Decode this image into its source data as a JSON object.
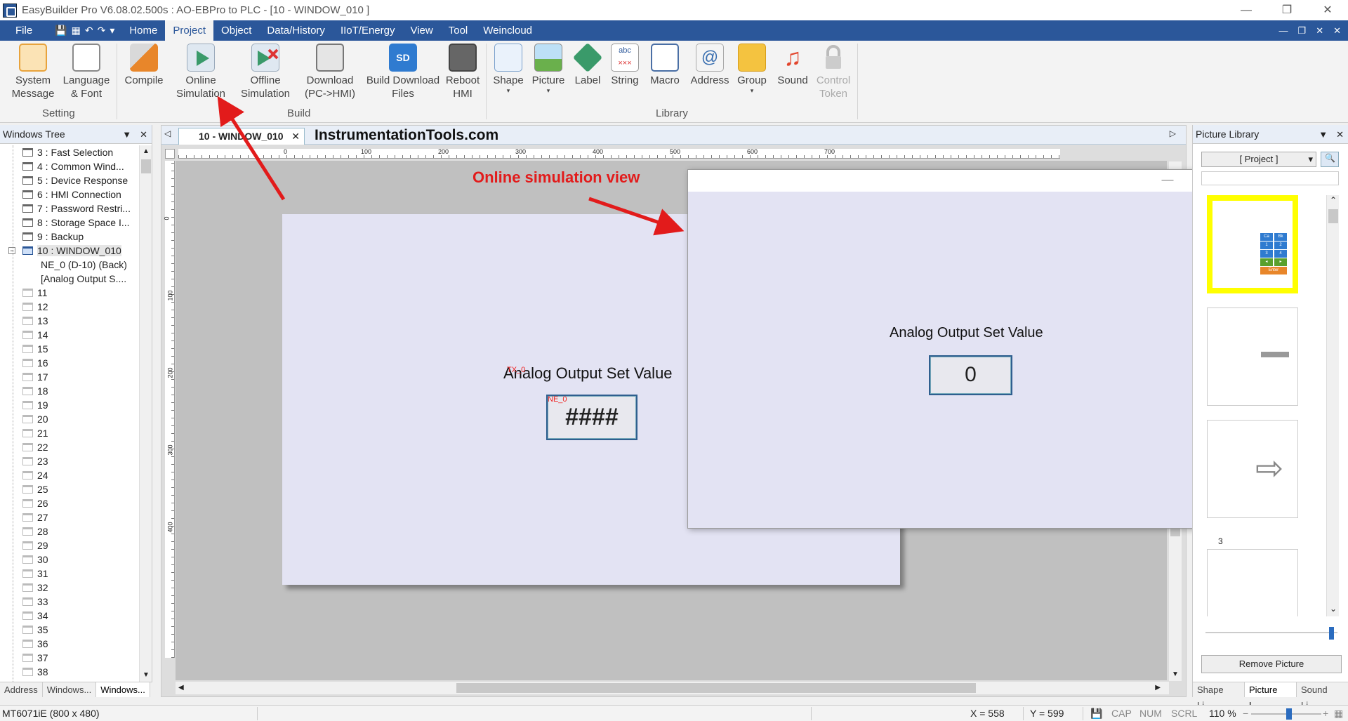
{
  "window": {
    "title": "EasyBuilder Pro V6.08.02.500s : AO-EBPro to PLC - [10 - WINDOW_010 ]",
    "min_glyph": "—",
    "restore_glyph": "❐",
    "close_glyph": "✕"
  },
  "menu": {
    "items": [
      "File",
      "Home",
      "Project",
      "Object",
      "Data/History",
      "IIoT/Energy",
      "View",
      "Tool",
      "Weincloud"
    ],
    "active": "Project",
    "right_controls": [
      "—",
      "❐",
      "✕",
      "✕"
    ]
  },
  "ribbon": {
    "setting": {
      "label": "Setting",
      "buttons": [
        {
          "line1": "System",
          "line2": "Message"
        },
        {
          "line1": "Language",
          "line2": "& Font"
        }
      ]
    },
    "build": {
      "label": "Build",
      "buttons": [
        {
          "line1": "Compile",
          "line2": ""
        },
        {
          "line1": "Online",
          "line2": "Simulation"
        },
        {
          "line1": "Offline",
          "line2": "Simulation"
        },
        {
          "line1": "Download",
          "line2": "(PC->HMI)"
        },
        {
          "line1": "Build Download",
          "line2": "Files"
        },
        {
          "line1": "Reboot",
          "line2": "HMI"
        }
      ]
    },
    "library": {
      "label": "Library",
      "buttons": [
        {
          "line1": "Shape",
          "line2": "▾"
        },
        {
          "line1": "Picture",
          "line2": "▾"
        },
        {
          "line1": "Label",
          "line2": ""
        },
        {
          "line1": "String",
          "line2": ""
        },
        {
          "line1": "Macro",
          "line2": ""
        },
        {
          "line1": "Address",
          "line2": ""
        },
        {
          "line1": "Group",
          "line2": "▾"
        },
        {
          "line1": "Sound",
          "line2": ""
        },
        {
          "line1": "Control",
          "line2": "Token"
        }
      ]
    },
    "icon_glyphs": {
      "sd": "SD",
      "abc": "abc",
      "xxx": "×××",
      "at": "@"
    }
  },
  "windows_tree": {
    "title": "Windows Tree",
    "controls": [
      "▼",
      "✕"
    ],
    "expander": "−",
    "items": [
      {
        "label": "3 : Fast Selection",
        "kind": "window"
      },
      {
        "label": "4 : Common Wind...",
        "kind": "window"
      },
      {
        "label": "5 : Device Response",
        "kind": "window"
      },
      {
        "label": "6 : HMI Connection",
        "kind": "window"
      },
      {
        "label": "7 : Password Restri...",
        "kind": "window"
      },
      {
        "label": "8 : Storage Space I...",
        "kind": "window"
      },
      {
        "label": "9 : Backup",
        "kind": "window"
      },
      {
        "label": "10 : WINDOW_010",
        "kind": "selected"
      },
      {
        "label": "NE_0 (D-10) (Back)",
        "kind": "child"
      },
      {
        "label": "[Analog Output S....",
        "kind": "child"
      },
      {
        "label": "11",
        "kind": "empty"
      },
      {
        "label": "12",
        "kind": "empty"
      },
      {
        "label": "13",
        "kind": "empty"
      },
      {
        "label": "14",
        "kind": "empty"
      },
      {
        "label": "15",
        "kind": "empty"
      },
      {
        "label": "16",
        "kind": "empty"
      },
      {
        "label": "17",
        "kind": "empty"
      },
      {
        "label": "18",
        "kind": "empty"
      },
      {
        "label": "19",
        "kind": "empty"
      },
      {
        "label": "20",
        "kind": "empty"
      },
      {
        "label": "21",
        "kind": "empty"
      },
      {
        "label": "22",
        "kind": "empty"
      },
      {
        "label": "23",
        "kind": "empty"
      },
      {
        "label": "24",
        "kind": "empty"
      },
      {
        "label": "25",
        "kind": "empty"
      },
      {
        "label": "26",
        "kind": "empty"
      },
      {
        "label": "27",
        "kind": "empty"
      },
      {
        "label": "28",
        "kind": "empty"
      },
      {
        "label": "29",
        "kind": "empty"
      },
      {
        "label": "30",
        "kind": "empty"
      },
      {
        "label": "31",
        "kind": "empty"
      },
      {
        "label": "32",
        "kind": "empty"
      },
      {
        "label": "33",
        "kind": "empty"
      },
      {
        "label": "34",
        "kind": "empty"
      },
      {
        "label": "35",
        "kind": "empty"
      },
      {
        "label": "36",
        "kind": "empty"
      },
      {
        "label": "37",
        "kind": "empty"
      },
      {
        "label": "38",
        "kind": "empty"
      }
    ],
    "bottom_tabs": [
      {
        "label": "Address",
        "active": false
      },
      {
        "label": "Windows...",
        "active": false
      },
      {
        "label": "Windows...",
        "active": true
      }
    ]
  },
  "editor": {
    "tab_label": "10 - WINDOW_010",
    "tab_close": "✕",
    "nav_left": "◁",
    "nav_right": "▷",
    "site_label": "InstrumentationTools.com",
    "ruler_h": [
      "0",
      "100",
      "200",
      "300",
      "400",
      "500",
      "600",
      "700"
    ],
    "ruler_v": [
      "0",
      "100",
      "200",
      "300",
      "400"
    ],
    "title_text": "Analog Output Set Value",
    "ne_tag_overlap": "TX_0",
    "ne_tag": "NE_0",
    "numentry_display": "####",
    "scroll_arrows": {
      "up": "▲",
      "down": "▼",
      "left": "◀",
      "right": "▶"
    }
  },
  "annotation": {
    "text": "Online simulation view"
  },
  "simulation": {
    "title_text": "Analog Output Set Value",
    "value": "0",
    "controls": [
      "—",
      "☐",
      "✕"
    ]
  },
  "picture_library": {
    "title": "Picture Library",
    "controls": [
      "▼",
      "✕"
    ],
    "combo_value": "[ Project ]",
    "combo_arrow": "▾",
    "search_glyph": "🔍",
    "thumb_number": "3",
    "thumb_glyph": "⇨",
    "keypad_keys": [
      "Ca",
      "Bk",
      "1",
      "2",
      "3",
      "4",
      "◂",
      "▸",
      "Enter"
    ],
    "scroll_up": "⌃",
    "scroll_down": "⌄",
    "remove_label": "Remove Picture",
    "bottom_tabs": [
      {
        "label": "Shape Li...",
        "active": false
      },
      {
        "label": "Picture L...",
        "active": true
      },
      {
        "label": "Sound Li...",
        "active": false
      }
    ]
  },
  "statusbar": {
    "model": "MT6071iE (800 x 480)",
    "x": "X = 558",
    "y": "Y = 599",
    "cap": "CAP",
    "num": "NUM",
    "scrl": "SCRL",
    "zoom": "110 %",
    "zoom_minus": "−",
    "zoom_plus": "+"
  },
  "colors": {
    "menubar": "#2b579a",
    "annotation": "#e21b1b",
    "canvas": "#e3e3f3"
  }
}
